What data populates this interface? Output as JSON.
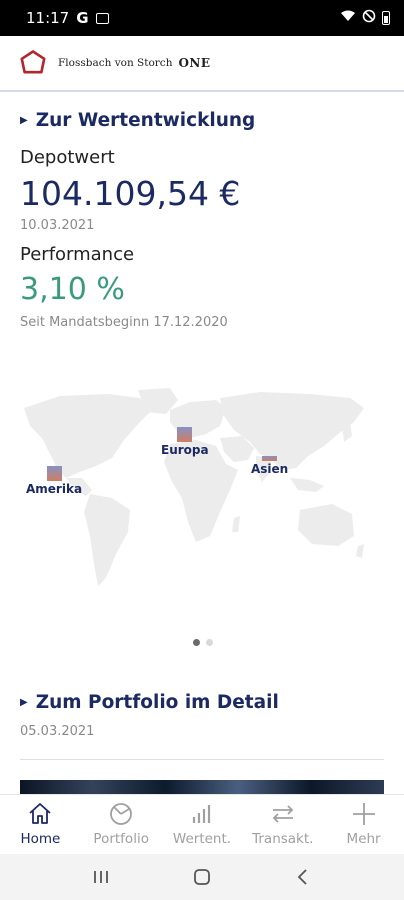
{
  "status_bar": {
    "time": "11:17",
    "g_badge": "G"
  },
  "brand": {
    "name": "Flossbach von Storch",
    "suffix": "ONE"
  },
  "performance_section": {
    "link_label": "Zur Wertentwicklung",
    "depot_label": "Depotwert",
    "depot_value": "104.109,54 €",
    "depot_date": "10.03.2021",
    "performance_label": "Performance",
    "performance_value": "3,10 %",
    "since_text": "Seit Mandatsbeginn 17.12.2020"
  },
  "map": {
    "regions": [
      {
        "label": "Amerika"
      },
      {
        "label": "Europa"
      },
      {
        "label": "Asien"
      }
    ]
  },
  "carousel": {
    "pages": 2,
    "active": 0
  },
  "portfolio_section": {
    "link_label": "Zum Portfolio im Detail",
    "date": "05.03.2021"
  },
  "bottom_nav": {
    "items": [
      {
        "label": "Home",
        "icon": "home-icon",
        "active": true
      },
      {
        "label": "Portfolio",
        "icon": "pie-icon",
        "active": false
      },
      {
        "label": "Wertent.",
        "icon": "bar-chart-icon",
        "active": false
      },
      {
        "label": "Transakt.",
        "icon": "transfer-icon",
        "active": false
      },
      {
        "label": "Mehr",
        "icon": "plus-icon",
        "active": false
      }
    ]
  },
  "colors": {
    "navy": "#1b2a63",
    "green": "#3a9a7c",
    "logo_red": "#b3262e",
    "gray_text": "#8a8a8a"
  }
}
